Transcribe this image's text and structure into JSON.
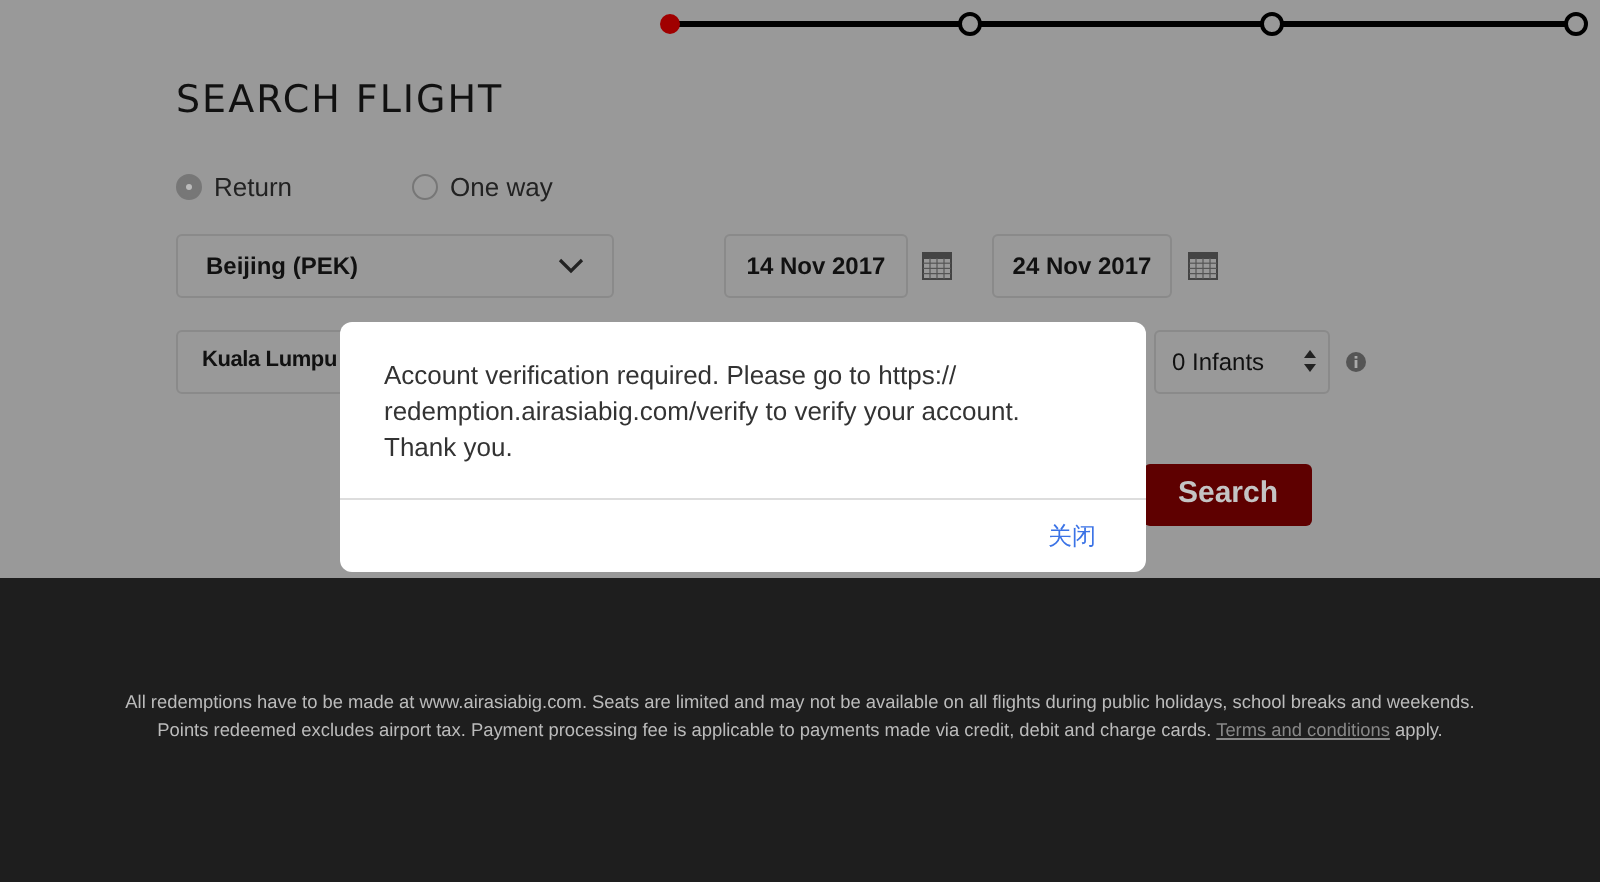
{
  "progress_steps": [
    {
      "selected": true
    },
    {
      "selected": false
    },
    {
      "selected": false
    },
    {
      "selected": false
    }
  ],
  "heading": "SEARCH FLIGHT",
  "trip_types": [
    {
      "label": "Return",
      "selected": true
    },
    {
      "label": "One way",
      "selected": false
    }
  ],
  "origin": {
    "value": "Beijing (PEK)"
  },
  "depart_date": {
    "value": "14 Nov 2017"
  },
  "return_date": {
    "value": "24 Nov 2017"
  },
  "destination": {
    "value": "Kuala Lumpu"
  },
  "infants": {
    "value": "0 Infants"
  },
  "search_button": "Search",
  "dialog": {
    "message": "Account verification required. Please go to https://\nredemption.airasiabig.com/verify to verify your account.\nThank you.",
    "close_button": "关闭"
  },
  "footer": [
    {
      "text": "All redemptions have to be made at www.airasiabig.com. Seats are limited and may not be available on all flights during public holidays, school breaks and weekends."
    },
    {
      "text": "Points redeemed excludes airport tax. Payment processing fee is applicable to payments made via credit, debit and charge cards.",
      "link": "Terms and conditions",
      "after": "apply."
    }
  ]
}
